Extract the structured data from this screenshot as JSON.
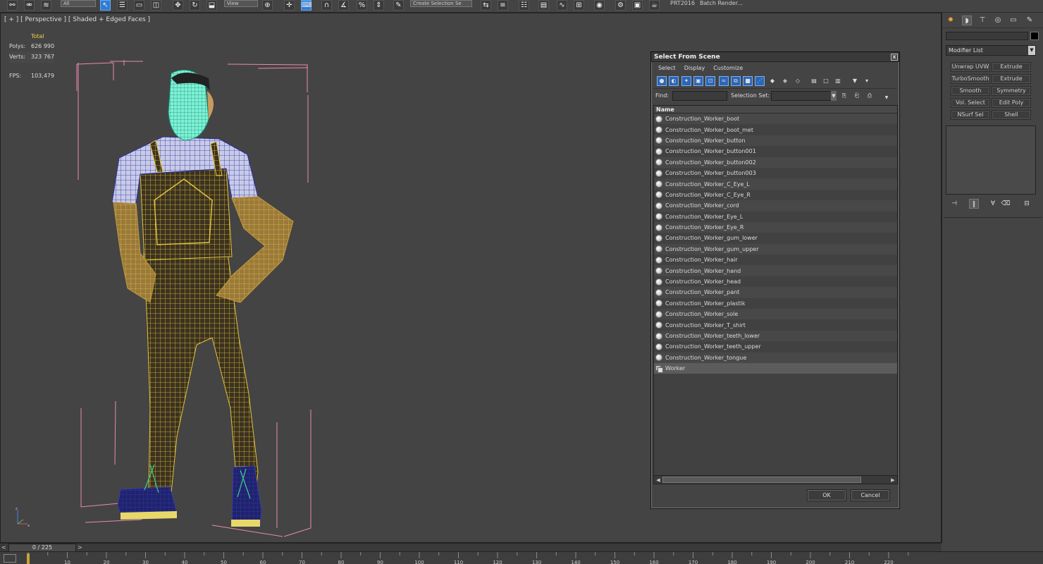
{
  "toolbar": {
    "layer_dropdown": "All",
    "view_dropdown": "View",
    "selection_set_placeholder": "Create Selection Se",
    "prt_label": "PRT2016",
    "batch_render_label": "Batch Render..."
  },
  "viewport": {
    "label": "[ + ] [ Perspective ] [ Shaded + Edged Faces ]",
    "stats": {
      "total_label": "Total",
      "polys_label": "Polys:",
      "polys_value": "626 990",
      "verts_label": "Verts:",
      "verts_value": "323 767",
      "fps_label": "FPS:",
      "fps_value": "103,479"
    }
  },
  "dialog": {
    "title": "Select From Scene",
    "close": "x",
    "menu": [
      "Select",
      "Display",
      "Customize"
    ],
    "find_label": "Find:",
    "selection_set_label": "Selection Set:",
    "list_header": "Name",
    "items": [
      "Construction_Worker_boot",
      "Construction_Worker_boot_met",
      "Construction_Worker_button",
      "Construction_Worker_button001",
      "Construction_Worker_button002",
      "Construction_Worker_button003",
      "Construction_Worker_C_Eye_L",
      "Construction_Worker_C_Eye_R",
      "Construction_Worker_cord",
      "Construction_Worker_Eye_L",
      "Construction_Worker_Eye_R",
      "Construction_Worker_gum_lower",
      "Construction_Worker_gum_upper",
      "Construction_Worker_hair",
      "Construction_Worker_hand",
      "Construction_Worker_head",
      "Construction_Worker_pant",
      "Construction_Worker_plastik",
      "Construction_Worker_sole",
      "Construction_Worker_T_shirt",
      "Construction_Worker_teeth_lower",
      "Construction_Worker_teeth_upper",
      "Construction_Worker_tongue"
    ],
    "group_item": "Worker",
    "ok_label": "OK",
    "cancel_label": "Cancel"
  },
  "command_panel": {
    "modifier_list": "Modifier List",
    "buttons": [
      [
        "Unwrap UVW",
        "Extrude"
      ],
      [
        "TurboSmooth",
        "Extrude"
      ],
      [
        "Smooth",
        "Symmetry"
      ],
      [
        "Vol. Select",
        "Edit Poly"
      ],
      [
        "NSurf Sel",
        "Shell"
      ]
    ]
  },
  "timeline": {
    "frame_display": "0 / 225",
    "prev": "<",
    "next": ">",
    "tick_labels": [
      "10",
      "20",
      "30",
      "40",
      "50",
      "60",
      "70",
      "80",
      "90",
      "100",
      "110",
      "120",
      "130",
      "140",
      "150",
      "160",
      "170",
      "180",
      "190",
      "200",
      "210",
      "220"
    ]
  }
}
